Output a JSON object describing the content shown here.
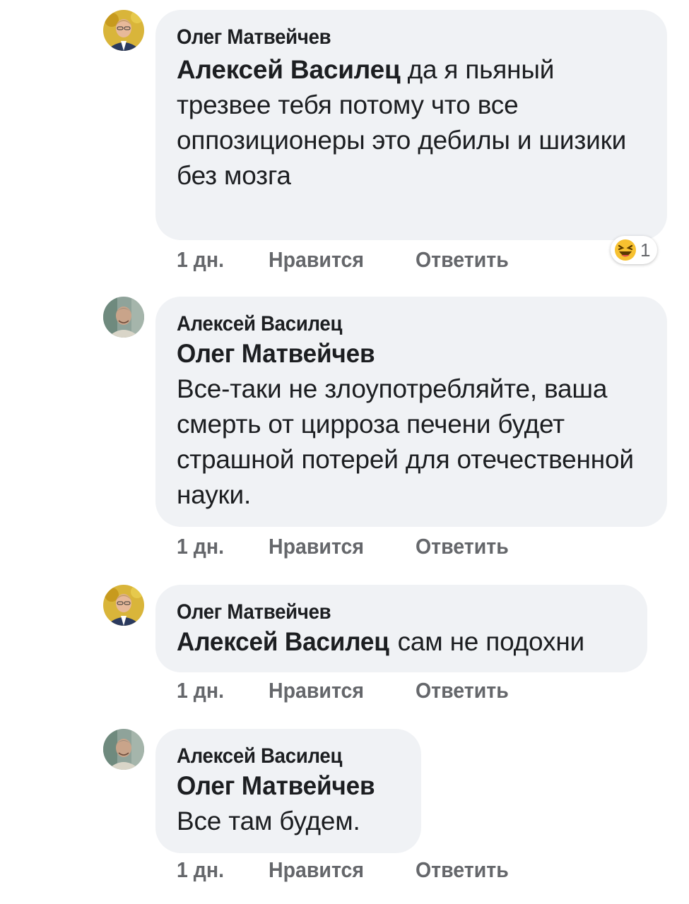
{
  "comments": [
    {
      "author": "Олег Матвейчев",
      "mention": "Алексей Василец",
      "text": " да я пьяный трезвее тебя  потому что все оппозиционеры  это дебилы и шизики  без мозга",
      "time": "1 дн.",
      "like_label": "Нравится",
      "reply_label": "Ответить",
      "reaction": {
        "icon": "laughing-emoji-icon",
        "count": "1"
      }
    },
    {
      "author": "Алексей Василец",
      "mention": "Олег Матвейчев",
      "text": "Все-таки не злоупотребляйте, ваша смерть от цирроза печени будет страшной потерей для отечественной науки.",
      "time": "1 дн.",
      "like_label": "Нравится",
      "reply_label": "Ответить"
    },
    {
      "author": "Олег Матвейчев",
      "mention": "Алексей Василец",
      "text": " сам не подохни",
      "time": "1 дн.",
      "like_label": "Нравится",
      "reply_label": "Ответить"
    },
    {
      "author": "Алексей Василец",
      "mention": "Олег Матвейчев",
      "text": "Все там будем.",
      "time": "1 дн.",
      "like_label": "Нравится",
      "reply_label": "Ответить"
    }
  ],
  "colors": {
    "bubble": "#f0f2f5",
    "text": "#1c1e21",
    "meta": "#65676b"
  }
}
